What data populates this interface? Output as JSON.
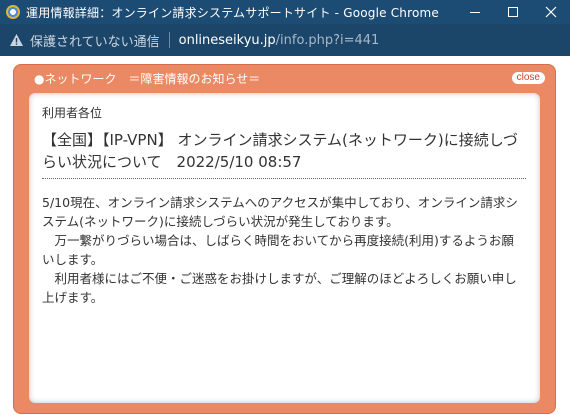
{
  "window": {
    "title": "運用情報詳細：オンライン請求システムサポートサイト - Google Chrome"
  },
  "addressbar": {
    "security": "保護されていない通信",
    "host": "onlineseikyu.jp",
    "path": "/info.php?i=441"
  },
  "notice": {
    "header": "●ネットワーク　＝障害情報のお知らせ＝",
    "close_label": "close",
    "addressee": "利用者各位",
    "headline": "【全国】【IP-VPN】 オンライン請求システム(ネットワーク)に接続しづらい状況について　2022/5/10 08:57",
    "paragraphs": [
      "5/10現在、オンライン請求システムへのアクセスが集中しており、オンライン請求システム(ネットワーク)に接続しづらい状況が発生しております。",
      "　万一繋がりづらい場合は、しばらく時間をおいてから再度接続(利用)するようお願いします。",
      "　利用者様にはご不便・ご迷惑をお掛けしますが、ご理解のほどよろしくお願い申し上げます。"
    ]
  },
  "colors": {
    "titlebar": "#1c4b74",
    "frame_accent": "#ea8963",
    "close_text": "#d2402e"
  },
  "icons": {
    "app": "chrome-app-icon",
    "warning": "warning-triangle-icon",
    "minimize": "minimize-icon",
    "maximize": "maximize-icon",
    "close": "close-icon"
  }
}
